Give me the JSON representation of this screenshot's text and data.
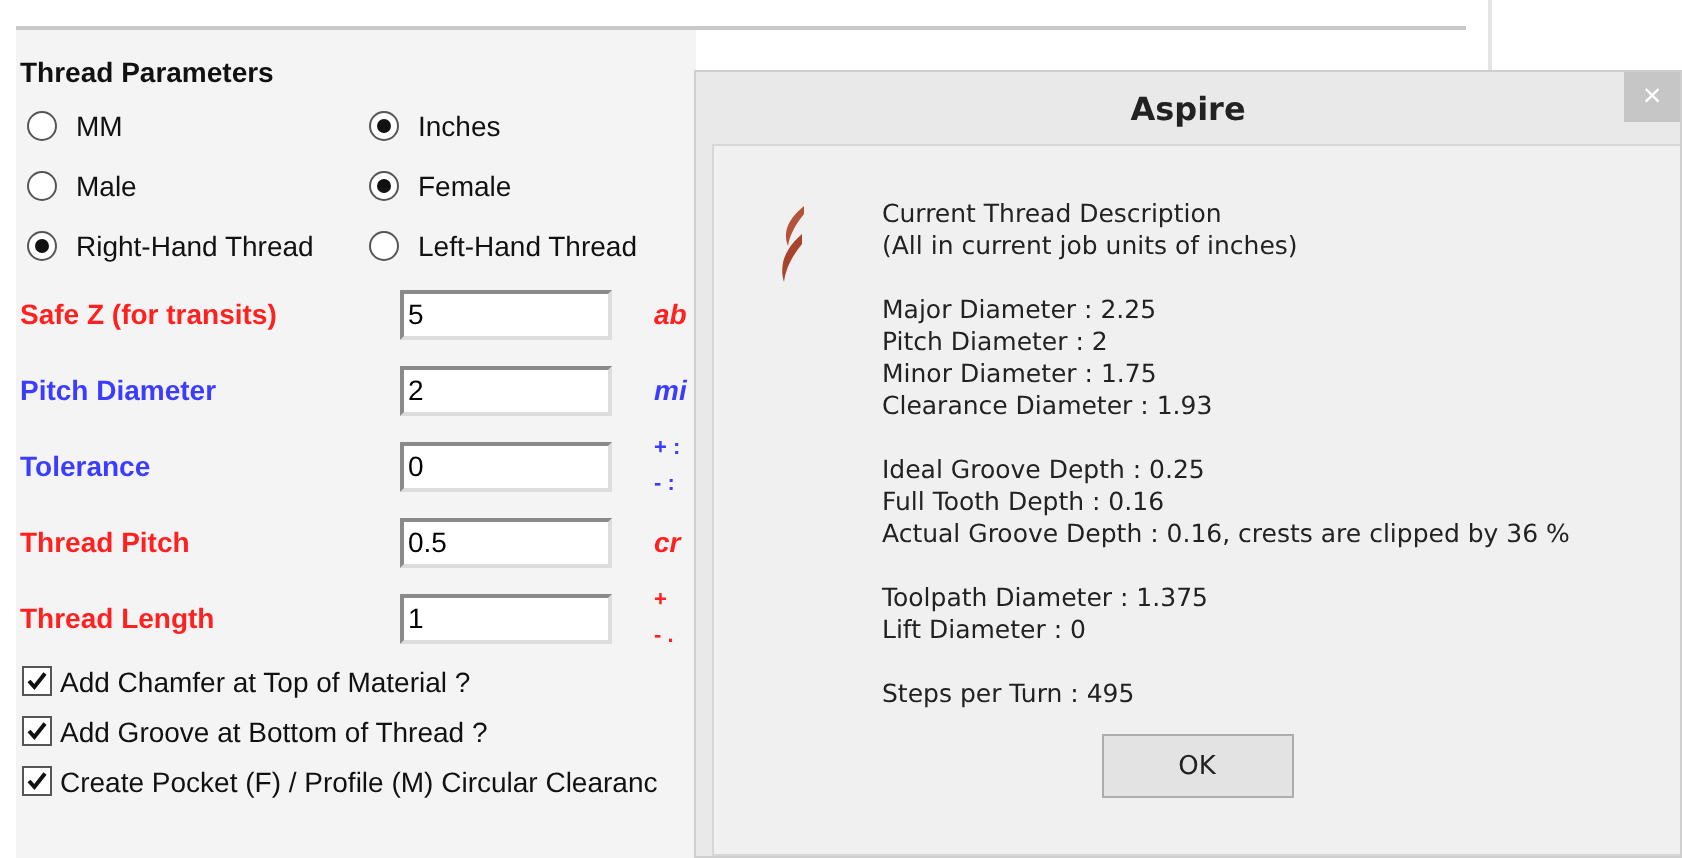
{
  "panel": {
    "heading": "Thread Parameters",
    "radio_groups": [
      {
        "options": [
          {
            "label": "MM",
            "selected": false
          },
          {
            "label": "Inches",
            "selected": true
          }
        ]
      },
      {
        "options": [
          {
            "label": "Male",
            "selected": false
          },
          {
            "label": "Female",
            "selected": true
          }
        ]
      },
      {
        "options": [
          {
            "label": "Right-Hand Thread",
            "selected": true
          },
          {
            "label": "Left-Hand Thread",
            "selected": false
          }
        ]
      }
    ],
    "fields": [
      {
        "label": "Safe Z (for transits)",
        "color": "#ff2020",
        "value": "5",
        "note": [
          "ab"
        ]
      },
      {
        "label": "Pitch Diameter",
        "color": "#3c3cff",
        "value": "2",
        "note": [
          "mi"
        ]
      },
      {
        "label": "Tolerance",
        "color": "#3c3cff",
        "value": "0",
        "note": [
          "+ :",
          "- :"
        ]
      },
      {
        "label": "Thread Pitch",
        "color": "#ff2020",
        "value": "0.5",
        "note": [
          "cr"
        ]
      },
      {
        "label": "Thread Length",
        "color": "#ff2020",
        "value": "1",
        "note": [
          "+",
          "- ."
        ]
      }
    ],
    "checkboxes": [
      {
        "label": "Add Chamfer at Top of Material ?",
        "checked": true
      },
      {
        "label": "Add Groove at Bottom of Thread ?",
        "checked": true
      },
      {
        "label": "Create Pocket (F) / Profile (M) Circular Clearanc",
        "checked": true
      }
    ]
  },
  "dialog": {
    "title": "Aspire",
    "close": "×",
    "paragraphs": [
      [
        "Current Thread Description",
        "(All in current job units of inches)"
      ],
      [
        "Major Diameter : 2.25",
        "Pitch Diameter : 2",
        "Minor Diameter : 1.75",
        "Clearance Diameter : 1.93"
      ],
      [
        "Ideal Groove Depth : 0.25",
        "Full Tooth Depth : 0.16",
        "Actual Groove Depth : 0.16, crests are clipped by 36 %"
      ],
      [
        "Toolpath Diameter : 1.375",
        "Lift Diameter : 0"
      ],
      [
        "Steps per Turn : 495"
      ]
    ],
    "button": "OK"
  }
}
